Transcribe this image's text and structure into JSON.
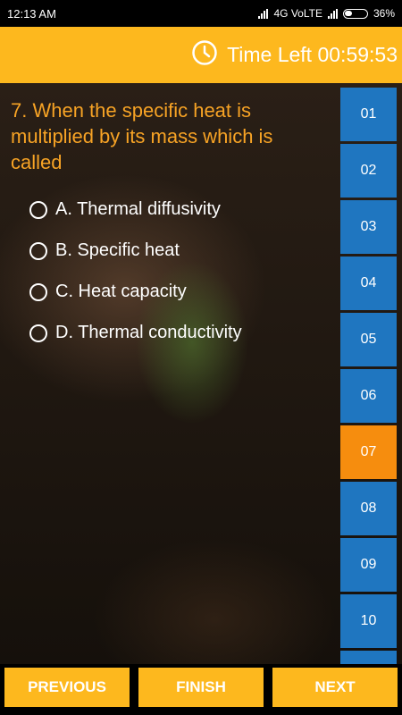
{
  "status_bar": {
    "time": "12:13 AM",
    "network": "4G VoLTE",
    "battery": "36%"
  },
  "header": {
    "timer_label": "Time Left",
    "timer_value": "00:59:53"
  },
  "question": {
    "text": "7. When the specific heat is multiplied by its mass which is called",
    "options": [
      {
        "label": "A. Thermal diffusivity"
      },
      {
        "label": "B. Specific heat"
      },
      {
        "label": "C. Heat capacity"
      },
      {
        "label": "D. Thermal conductivity"
      }
    ]
  },
  "question_nav": {
    "items": [
      "01",
      "02",
      "03",
      "04",
      "05",
      "06",
      "07",
      "08",
      "09",
      "10"
    ],
    "active": "07"
  },
  "footer": {
    "previous_label": "PREVIOUS",
    "finish_label": "FINISH",
    "next_label": "NEXT"
  },
  "colors": {
    "accent": "#fdb81e",
    "question_text": "#f7a325",
    "nav_button": "#1f76c0",
    "nav_active": "#f68d0e"
  },
  "icons": {
    "timer": "clock-icon",
    "option_marker": "radio-icon"
  }
}
